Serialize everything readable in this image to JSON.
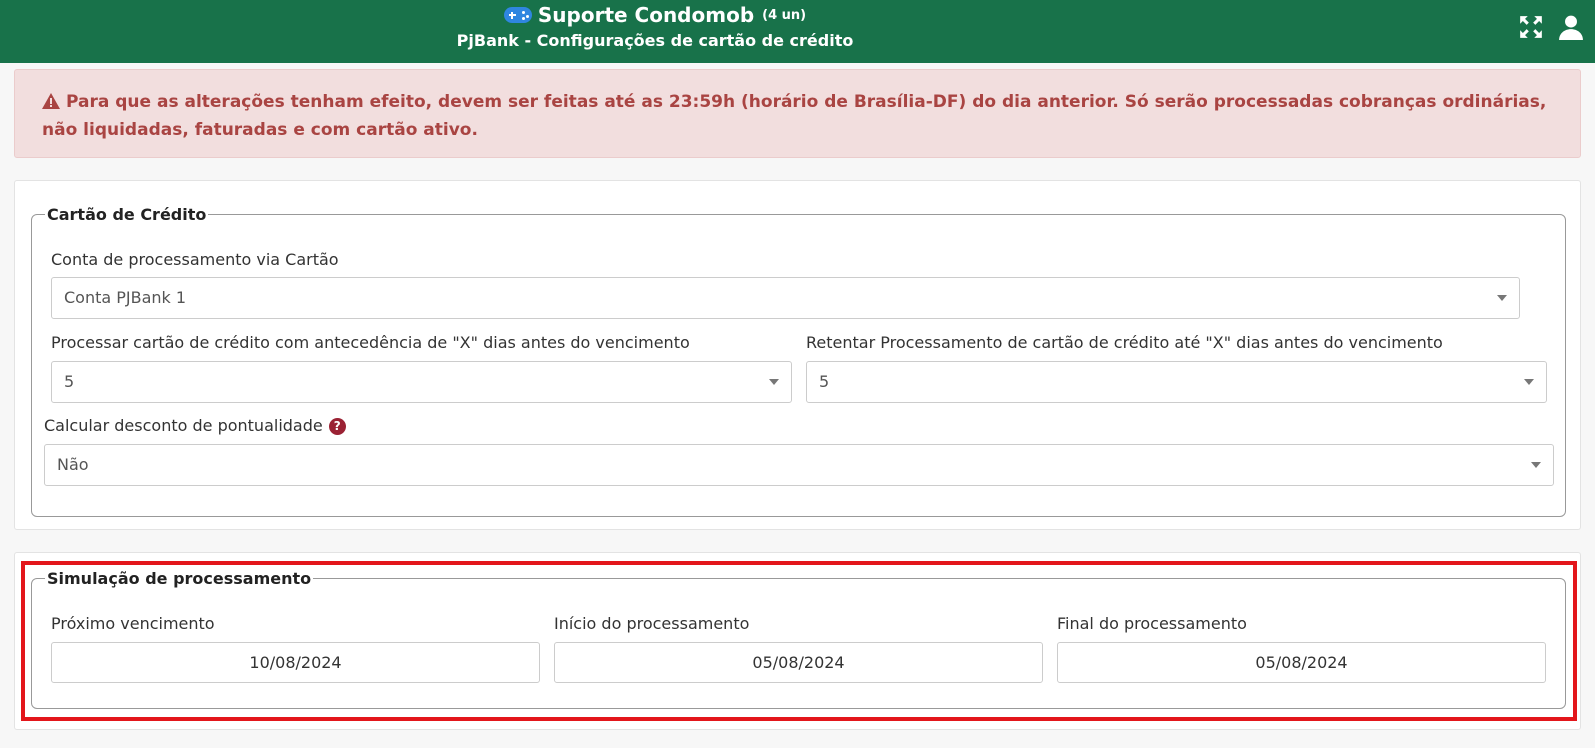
{
  "header": {
    "title": "Suporte Condomob",
    "units": "(4 un)",
    "subtitle": "PjBank - Configurações de cartão de crédito"
  },
  "alert": {
    "text": "Para que as alterações tenham efeito, devem ser feitas até as 23:59h (horário de Brasília-DF) do dia anterior. Só serão processadas cobranças ordinárias, não liquidadas, faturadas e com cartão ativo."
  },
  "credit_card": {
    "legend": "Cartão de Crédito",
    "account_label": "Conta de processamento via Cartão",
    "account_value": "Conta PJBank 1",
    "advance_label": "Processar cartão de crédito com antecedência de \"X\" dias antes do vencimento",
    "advance_value": "5",
    "retry_label": "Retentar Processamento de cartão de crédito até \"X\" dias antes do vencimento",
    "retry_value": "5",
    "discount_label": "Calcular desconto de pontualidade",
    "discount_value": "Não"
  },
  "simulation": {
    "legend": "Simulação de processamento",
    "next_due_label": "Próximo vencimento",
    "next_due_value": "10/08/2024",
    "start_label": "Início do processamento",
    "start_value": "05/08/2024",
    "end_label": "Final do processamento",
    "end_value": "05/08/2024"
  },
  "colors": {
    "header_bg": "#18724a",
    "alert_bg": "#f2dede",
    "alert_text": "#a94442",
    "highlight": "#e3161b"
  },
  "icons": {
    "header": "gamepad-icon",
    "expand": "expand-icon",
    "user": "user-icon",
    "warning": "warning-icon",
    "help": "question-circle-icon"
  }
}
